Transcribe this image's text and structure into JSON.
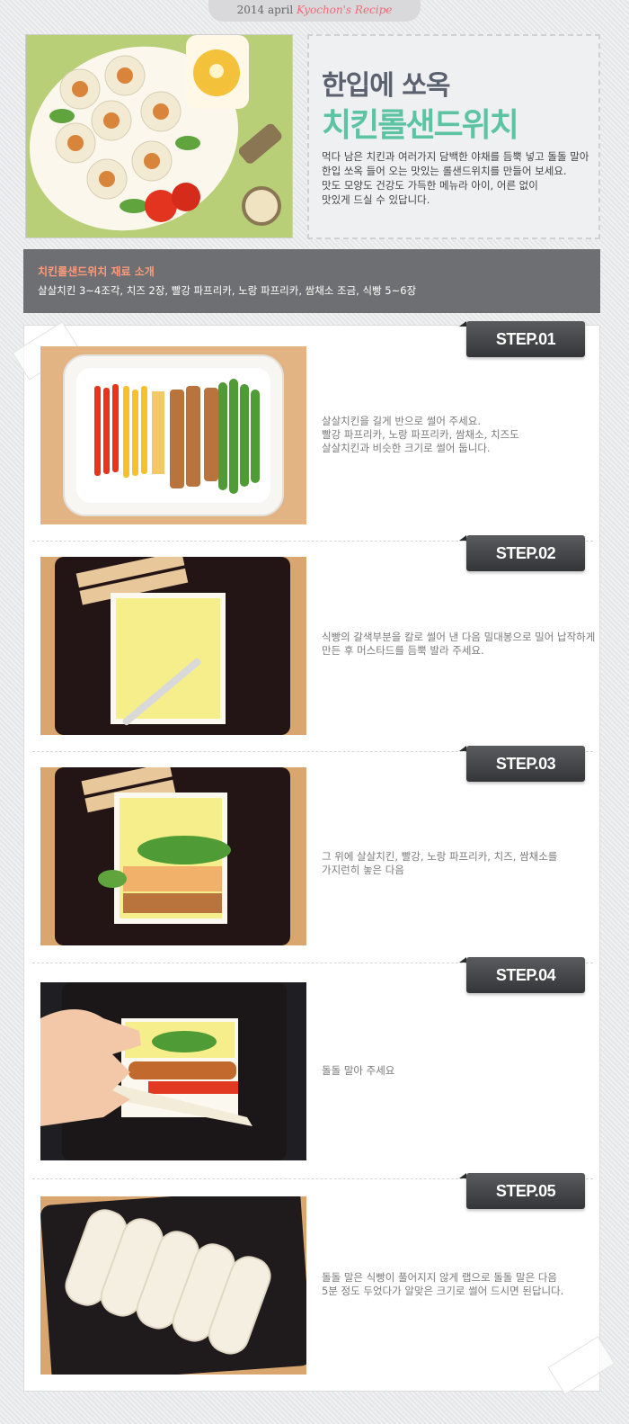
{
  "header": {
    "tab_prefix": "2014 april ",
    "tab_brand": "Kyochon's Recipe"
  },
  "hero": {
    "title_line1": "한입에 쏘옥",
    "title_line2": "치킨롤샌드위치",
    "desc_lines": [
      "먹다 남은 치킨과 여러가지 담백한 야채를 듬뿍 넣고 돌돌 말아",
      "한입 쏘옥 들어 오는 맛있는 롤샌드위치를 만들어 보세요.",
      "맛도 모양도 건강도 가득한 메뉴라 아이, 어른 없이",
      "맛있게 드실 수 있답니다."
    ]
  },
  "ingredients": {
    "title": "치킨롤샌드위치 재료 소개",
    "list": "살살치킨 3~4조각, 치즈 2장, 빨강 파프리카, 노랑 파프리카, 쌈채소 조금, 식빵 5~6장"
  },
  "steps": [
    {
      "label": "STEP.01",
      "text_lines": [
        "살살치킨을 길게 반으로 썰어 주세요.",
        "빨강 파프리카, 노랑 파프리카, 쌈채소, 치즈도",
        "살살치킨과 비슷한 크기로 썰어 둡니다."
      ]
    },
    {
      "label": "STEP.02",
      "text_lines": [
        "식빵의 갈색부분을 칼로 썰어 낸 다음 밀대봉으로 밀어 납작하게",
        "만든 후 머스타드를 듬뿍 발라 주세요."
      ]
    },
    {
      "label": "STEP.03",
      "text_lines": [
        "그 위에 살살치킨, 빨강, 노랑 파프리카, 치즈, 쌈채소를",
        "가지런히 놓은 다음"
      ]
    },
    {
      "label": "STEP.04",
      "text_lines": [
        "돌돌 말아 주세요"
      ]
    },
    {
      "label": "STEP.05",
      "text_lines": [
        "돌돌 말은 식빵이 풀어지지 않게 랩으로 돌돌 말은 다음",
        "5분 정도 두었다가 알맞은 크기로 썰어 드시면 된답니다."
      ]
    }
  ]
}
